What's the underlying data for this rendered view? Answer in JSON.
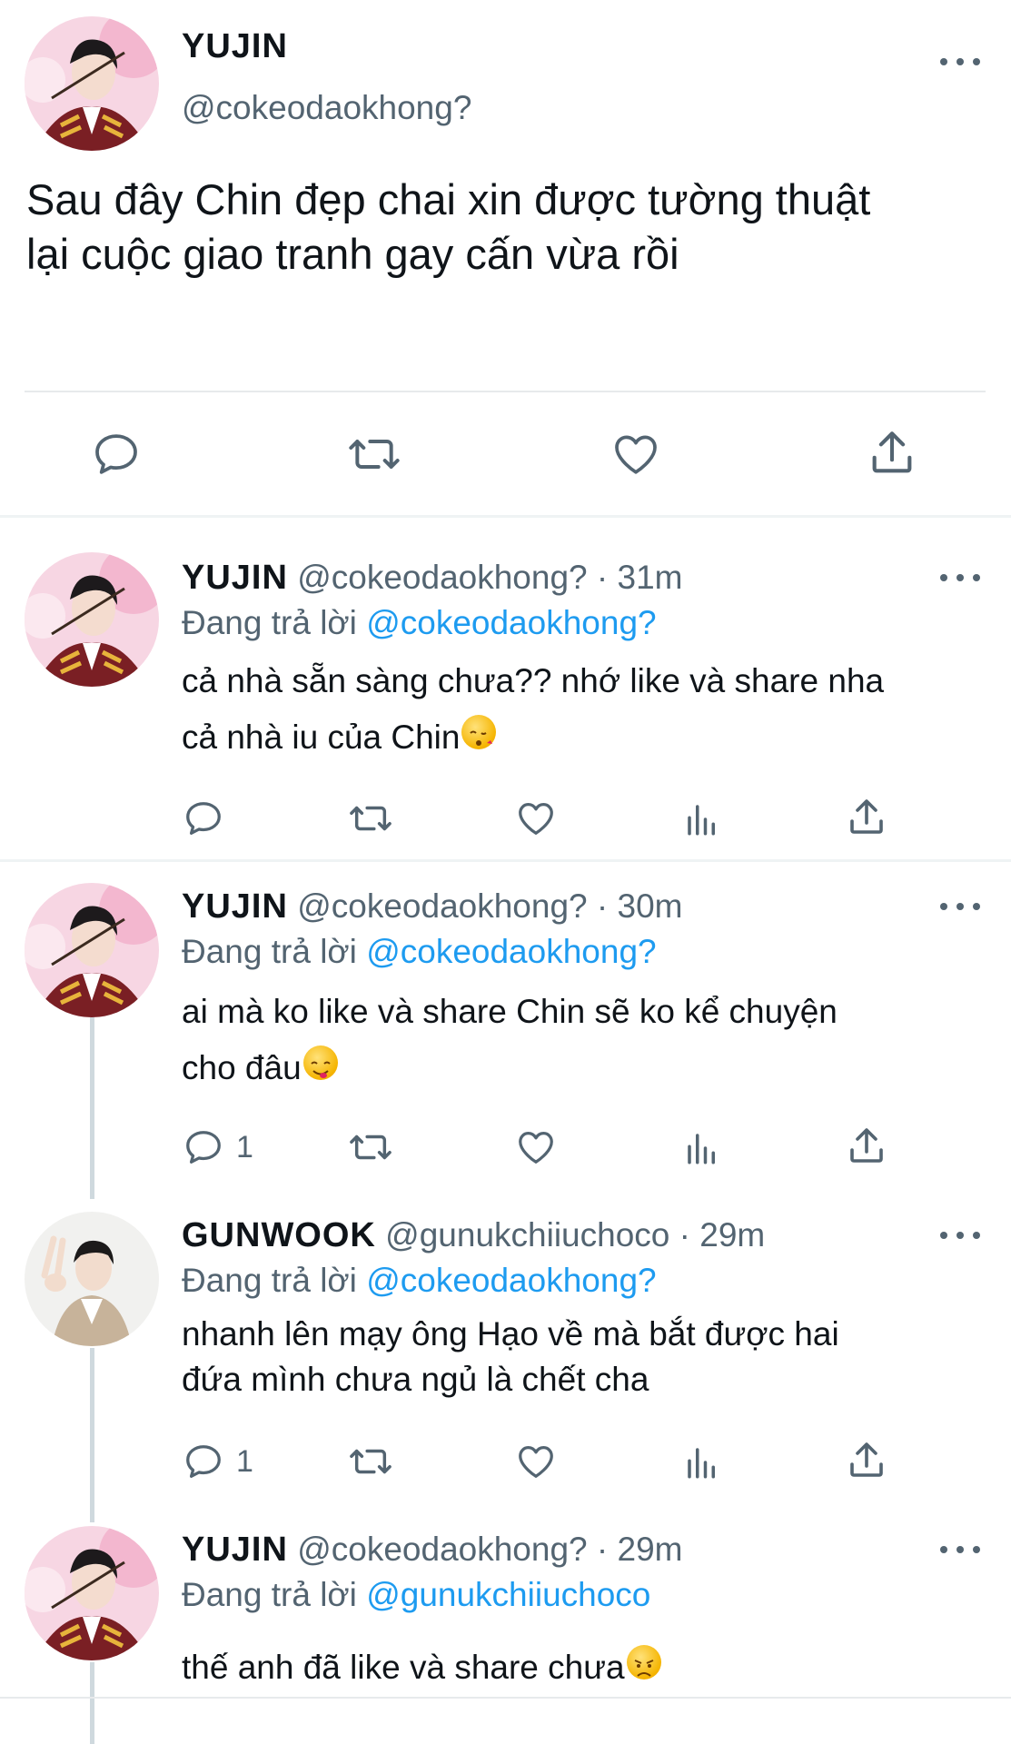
{
  "main_tweet": {
    "name": "YUJIN",
    "handle": "@cokeodaokhong?",
    "text_line1": "Sau đây Chin đẹp chai xin được tường thuật",
    "text_line2": "lại cuộc giao tranh gay cấn vừa rồi",
    "actions": [
      "reply-icon",
      "retweet-icon",
      "like-icon",
      "share-icon"
    ]
  },
  "replies": [
    {
      "name": "YUJIN",
      "handle": "@cokeodaokhong?",
      "time": "31m",
      "replying_label": "Đang trả lời",
      "replying_to": "@cokeodaokhong?",
      "line1": "cả nhà sẵn sàng chưa?? nhớ like và share nha",
      "line2": "cả nhà iu của Chin",
      "emoji": "kissing-face-emoji",
      "reply_count": ""
    },
    {
      "name": "YUJIN",
      "handle": "@cokeodaokhong?",
      "time": "30m",
      "replying_label": "Đang trả lời",
      "replying_to": "@cokeodaokhong?",
      "line1": "ai mà ko like và share Chin sẽ ko kể chuyện",
      "line2": "cho đâu",
      "emoji": "savoring-face-emoji",
      "reply_count": "1"
    },
    {
      "name": "GUNWOOK",
      "handle": "@gunukchiiuchoco",
      "time": "29m",
      "replying_label": "Đang trả lời",
      "replying_to": "@cokeodaokhong?",
      "line1": "nhanh lên mạy ông Hạo về mà bắt được hai",
      "line2": "đứa mình chưa ngủ là chết cha",
      "reply_count": "1"
    },
    {
      "name": "YUJIN",
      "handle": "@cokeodaokhong?",
      "time": "29m",
      "replying_label": "Đang trả lời",
      "replying_to": "@gunukchiiuchoco",
      "line1": "thế anh đã like và share chưa",
      "emoji": "angry-face-emoji"
    }
  ],
  "separator": "·",
  "colors": {
    "mention": "#1d9bf0",
    "secondary": "#536471",
    "primary": "#0f1419"
  }
}
